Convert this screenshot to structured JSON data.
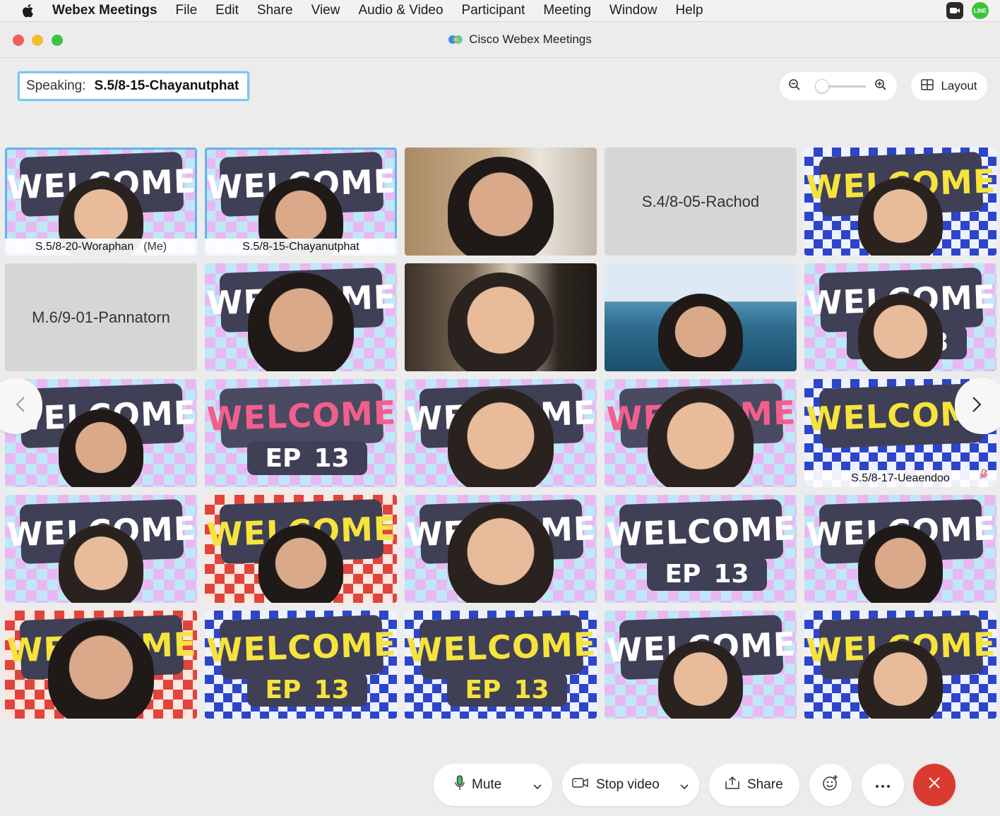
{
  "menubar": {
    "app_name": "Webex Meetings",
    "items": [
      "File",
      "Edit",
      "Share",
      "View",
      "Audio & Video",
      "Participant",
      "Meeting",
      "Window",
      "Help"
    ],
    "line_badge": "LINE"
  },
  "window": {
    "title": "Cisco Webex Meetings"
  },
  "speaking": {
    "label": "Speaking:",
    "name": "S.5/8-15-Chayanutphat"
  },
  "zoom": {
    "level": 0.0
  },
  "layout_button": {
    "label": "Layout"
  },
  "participants": [
    {
      "name": "S.5/8-20-Woraphan",
      "me_label": "(Me)"
    },
    {
      "name": "S.5/8-15-Chayanutphat"
    },
    {
      "name": "S.4/8-05-Rachod"
    },
    {
      "name": "M.6/9-01-Pannatorn"
    },
    {
      "name": "S.5/8-17-Ueaendoo"
    }
  ],
  "welcome": {
    "word": "WELCOME",
    "ep": "EP",
    "num": "13"
  },
  "toolbar": {
    "mute_label": "Mute",
    "video_label": "Stop video",
    "share_label": "Share"
  },
  "colors": {
    "accent": "#5fb6ea",
    "end_call": "#da3a2f"
  }
}
